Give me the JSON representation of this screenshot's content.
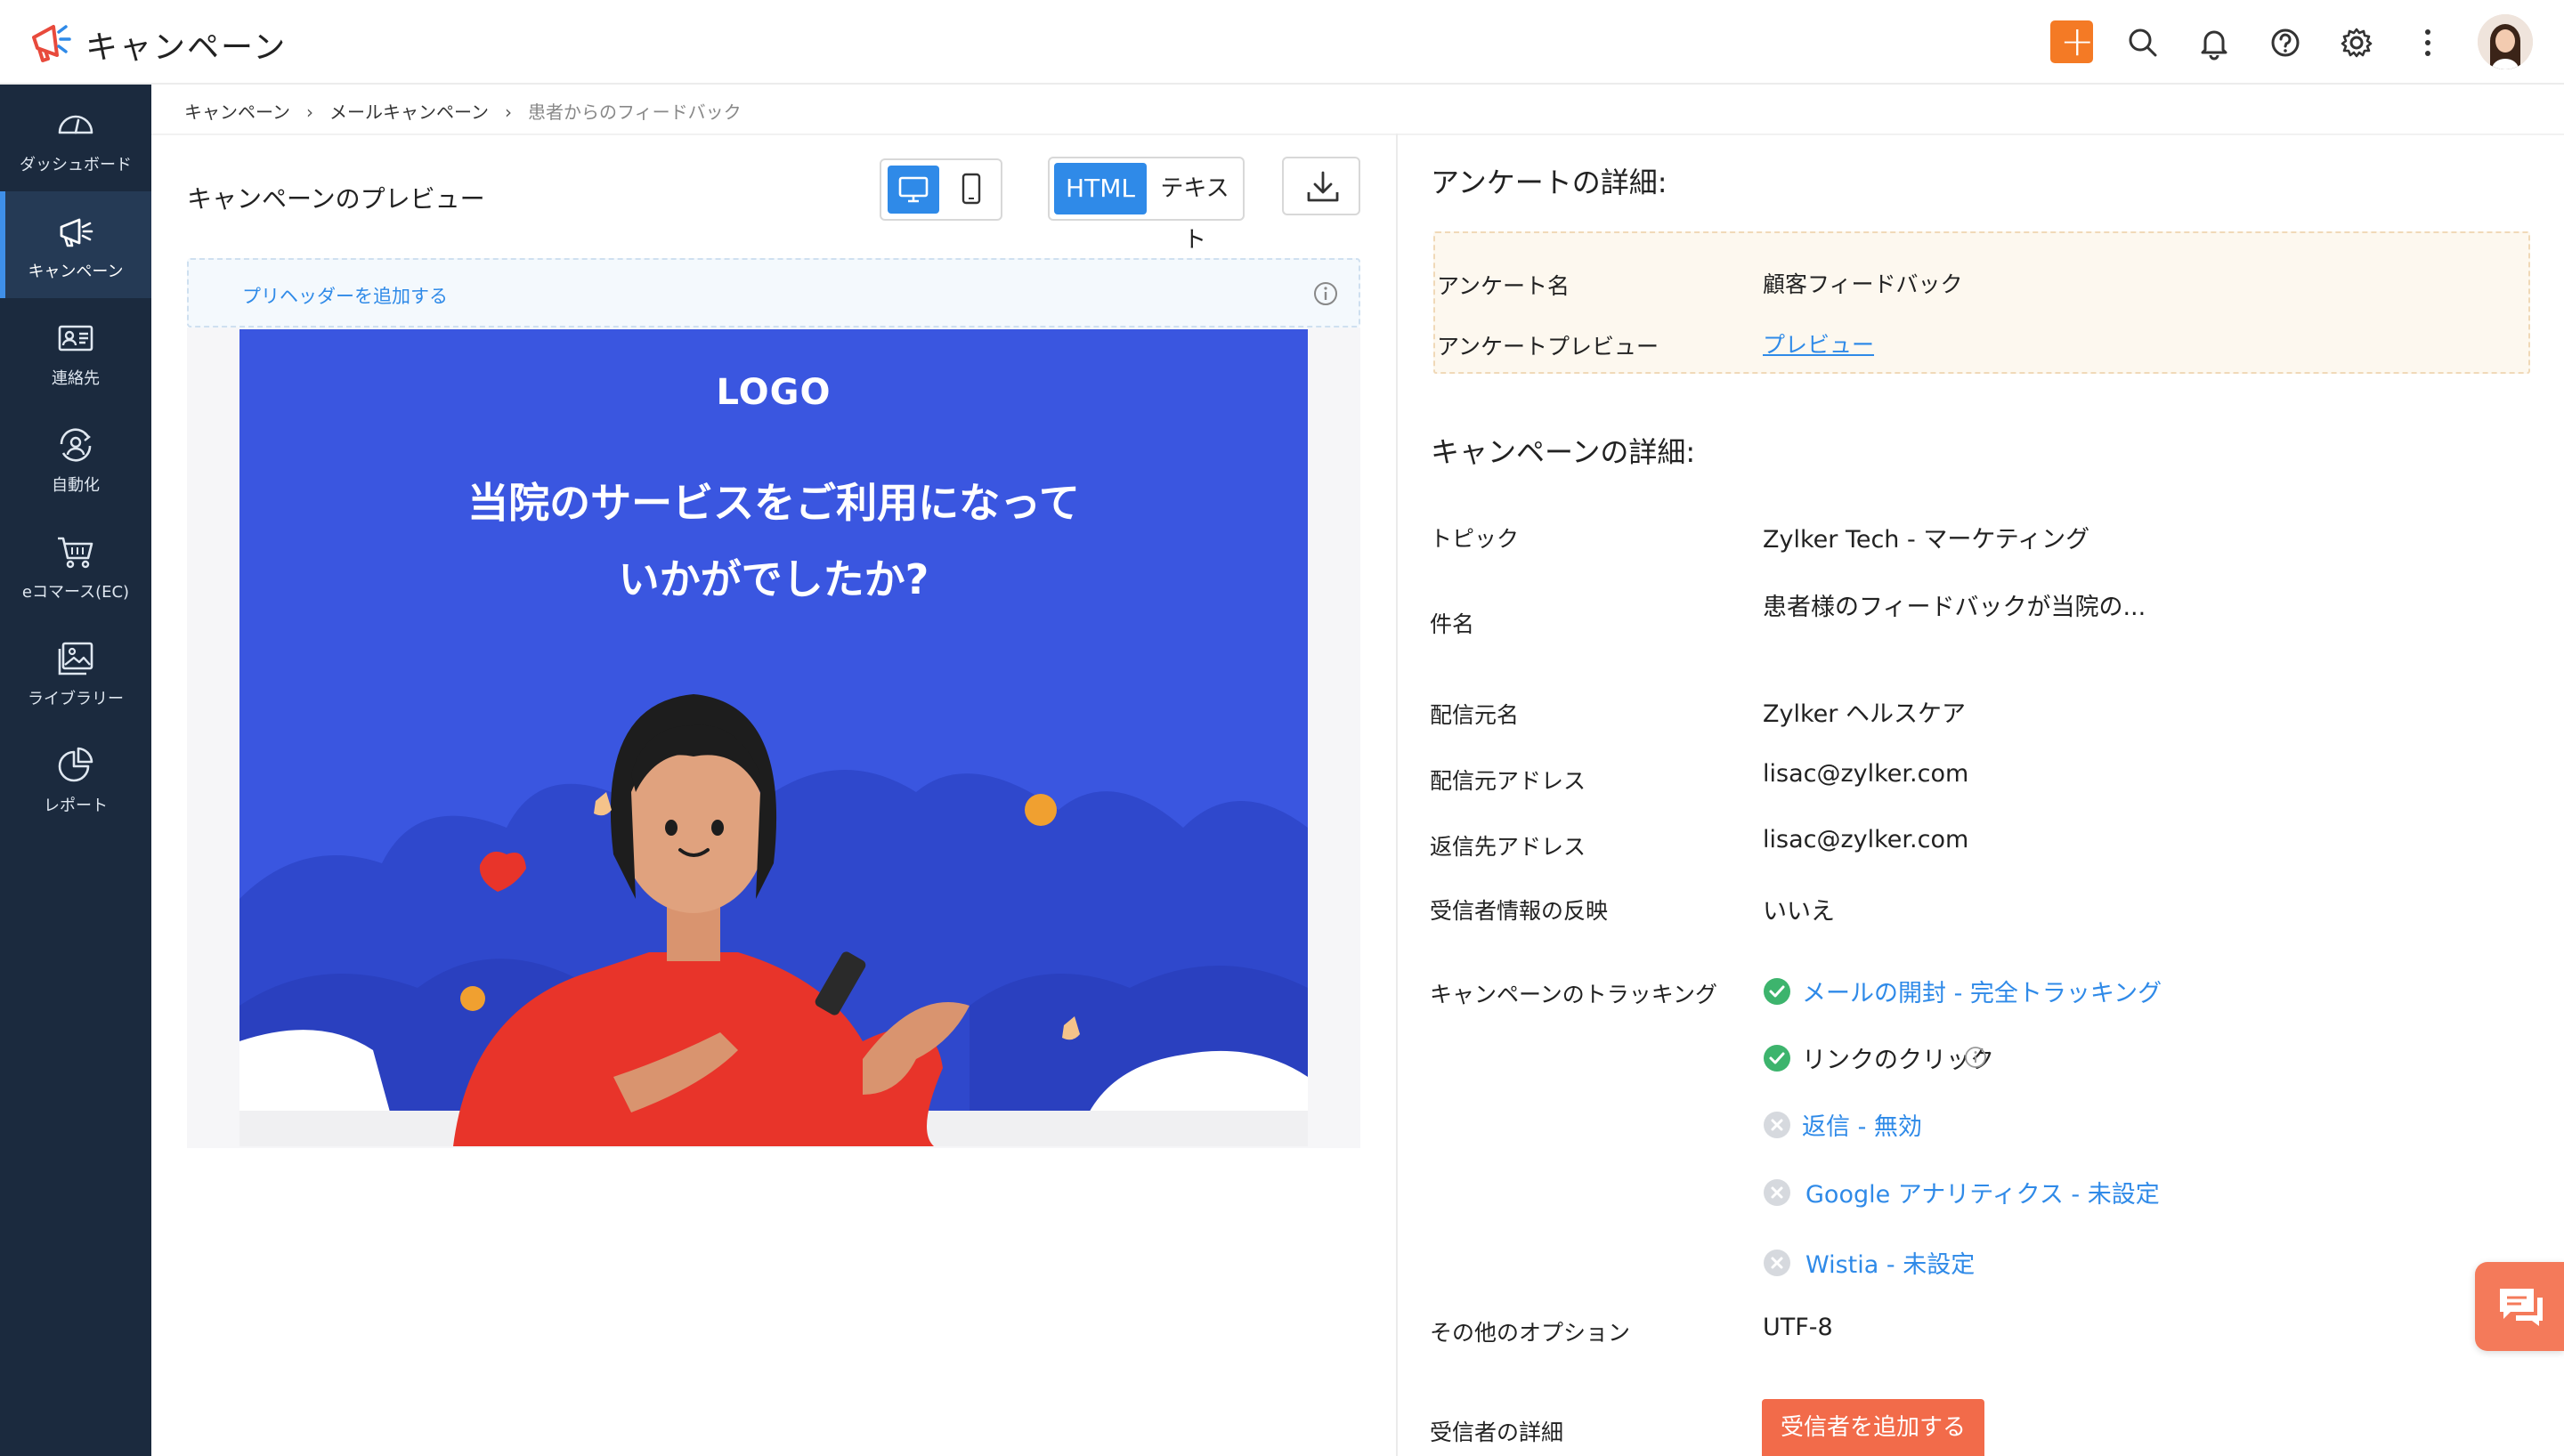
{
  "header": {
    "app_title": "キャンペーン",
    "icons": [
      "plus-icon",
      "search-icon",
      "bell-icon",
      "help-icon",
      "gear-icon",
      "more-vertical-icon"
    ],
    "accent_color": "#f47a25"
  },
  "sidebar": {
    "items": [
      {
        "label": "ダッシュボード",
        "icon": "dashboard-gauge-icon"
      },
      {
        "label": "キャンペーン",
        "icon": "megaphone-icon",
        "active": true
      },
      {
        "label": "連絡先",
        "icon": "contact-card-icon"
      },
      {
        "label": "自動化",
        "icon": "automation-icon"
      },
      {
        "label": "eコマース(EC)",
        "icon": "cart-icon"
      },
      {
        "label": "ライブラリー",
        "icon": "image-library-icon"
      },
      {
        "label": "レポート",
        "icon": "pie-chart-icon"
      }
    ]
  },
  "breadcrumb": {
    "items": [
      "キャンペーン",
      "メールキャンペーン",
      "患者からのフィードバック"
    ]
  },
  "preview": {
    "title": "キャンペーンのプレビュー",
    "html_label": "HTML",
    "text_label": "テキスト",
    "preheader_label": "プリヘッダーを追加する",
    "email": {
      "logo": "LOGO",
      "heading_line1": "当院のサービスをご利用になって",
      "heading_line2": "いかがでしたか?"
    }
  },
  "survey": {
    "title": "アンケートの詳細:",
    "name_label": "アンケート名",
    "name_value": "顧客フィードバック",
    "preview_label": "アンケートプレビュー",
    "preview_link": "プレビュー"
  },
  "campaign": {
    "title": "キャンペーンの詳細:",
    "topic_label": "トピック",
    "topic_value": "Zylker Tech - マーケティング",
    "subject_label": "件名",
    "subject_value": "患者様のフィードバックが当院の...",
    "sender_name_label": "配信元名",
    "sender_name_value": "Zylker ヘルスケア",
    "sender_address_label": "配信元アドレス",
    "sender_address_value": "lisac@zylker.com",
    "reply_address_label": "返信先アドレス",
    "reply_address_value": "lisac@zylker.com",
    "recipient_info_label": "受信者情報の反映",
    "recipient_info_value": "いいえ",
    "tracking_label": "キャンペーンのトラッキング",
    "tracking": [
      {
        "text": "メールの開封 - 完全トラッキング",
        "status": "enabled"
      },
      {
        "text": "リンクのクリック",
        "status": "enabled"
      },
      {
        "text": "返信 - 無効",
        "status": "disabled"
      },
      {
        "text": "Google アナリティクス - 未設定",
        "status": "disabled"
      },
      {
        "text": "Wistia - 未設定",
        "status": "disabled"
      }
    ],
    "other_options_label": "その他のオプション",
    "other_options_value": "UTF-8",
    "recipient_details_label": "受信者の詳細",
    "add_recipient_button": "受信者を追加する"
  },
  "colors": {
    "sidebar_bg": "#1b2a3e",
    "primary_blue": "#2f8ae8",
    "email_bg": "#3a56e0",
    "success_green": "#3db46d",
    "cta_orange": "#f26b4a"
  }
}
